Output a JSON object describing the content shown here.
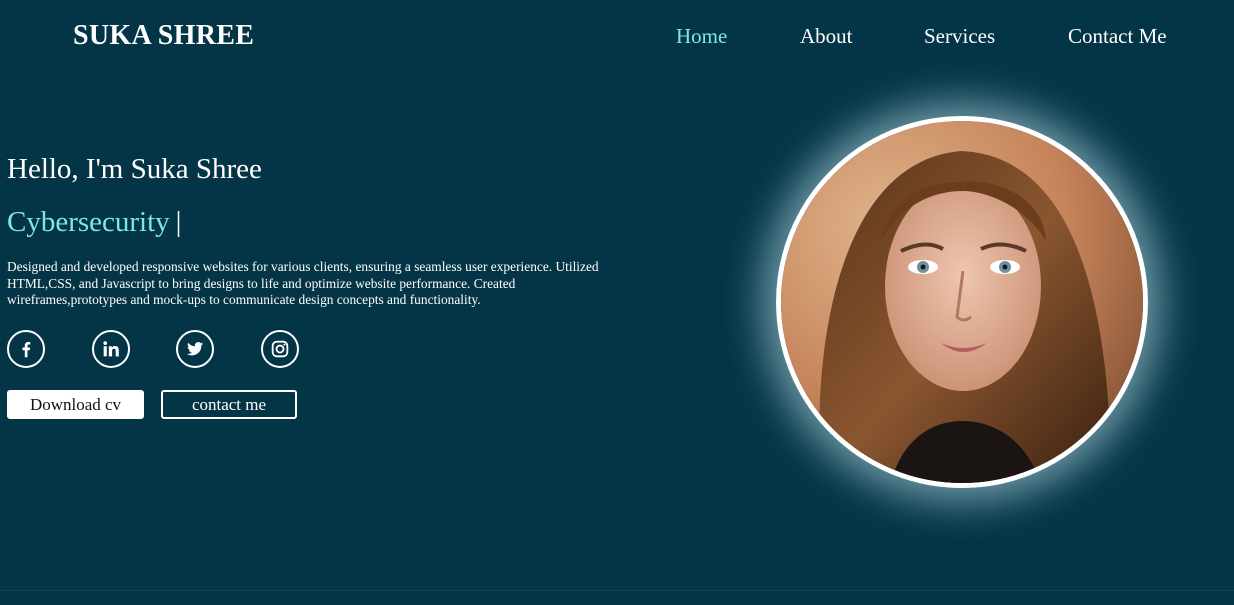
{
  "header": {
    "logo": "SUKA SHREE",
    "nav": [
      {
        "label": "Home",
        "active": true
      },
      {
        "label": "About",
        "active": false
      },
      {
        "label": "Services",
        "active": false
      },
      {
        "label": "Contact Me",
        "active": false
      }
    ]
  },
  "hero": {
    "greeting": "Hello, I'm Suka Shree",
    "role": "Cybersecurity",
    "cursor": "|",
    "description": "Designed and developed responsive websites for various clients, ensuring a seamless user experience. Utilized HTML,CSS, and Javascript to bring designs to life and optimize website performance. Created wireframes,prototypes and mock-ups to communicate design concepts and functionality.",
    "socials": [
      "facebook-icon",
      "linkedin-icon",
      "twitter-icon",
      "instagram-icon"
    ],
    "buttons": {
      "download": "Download cv",
      "contact": "contact me"
    }
  },
  "colors": {
    "background": "#033546",
    "accent": "#7fe6e6",
    "text": "#ffffff"
  }
}
